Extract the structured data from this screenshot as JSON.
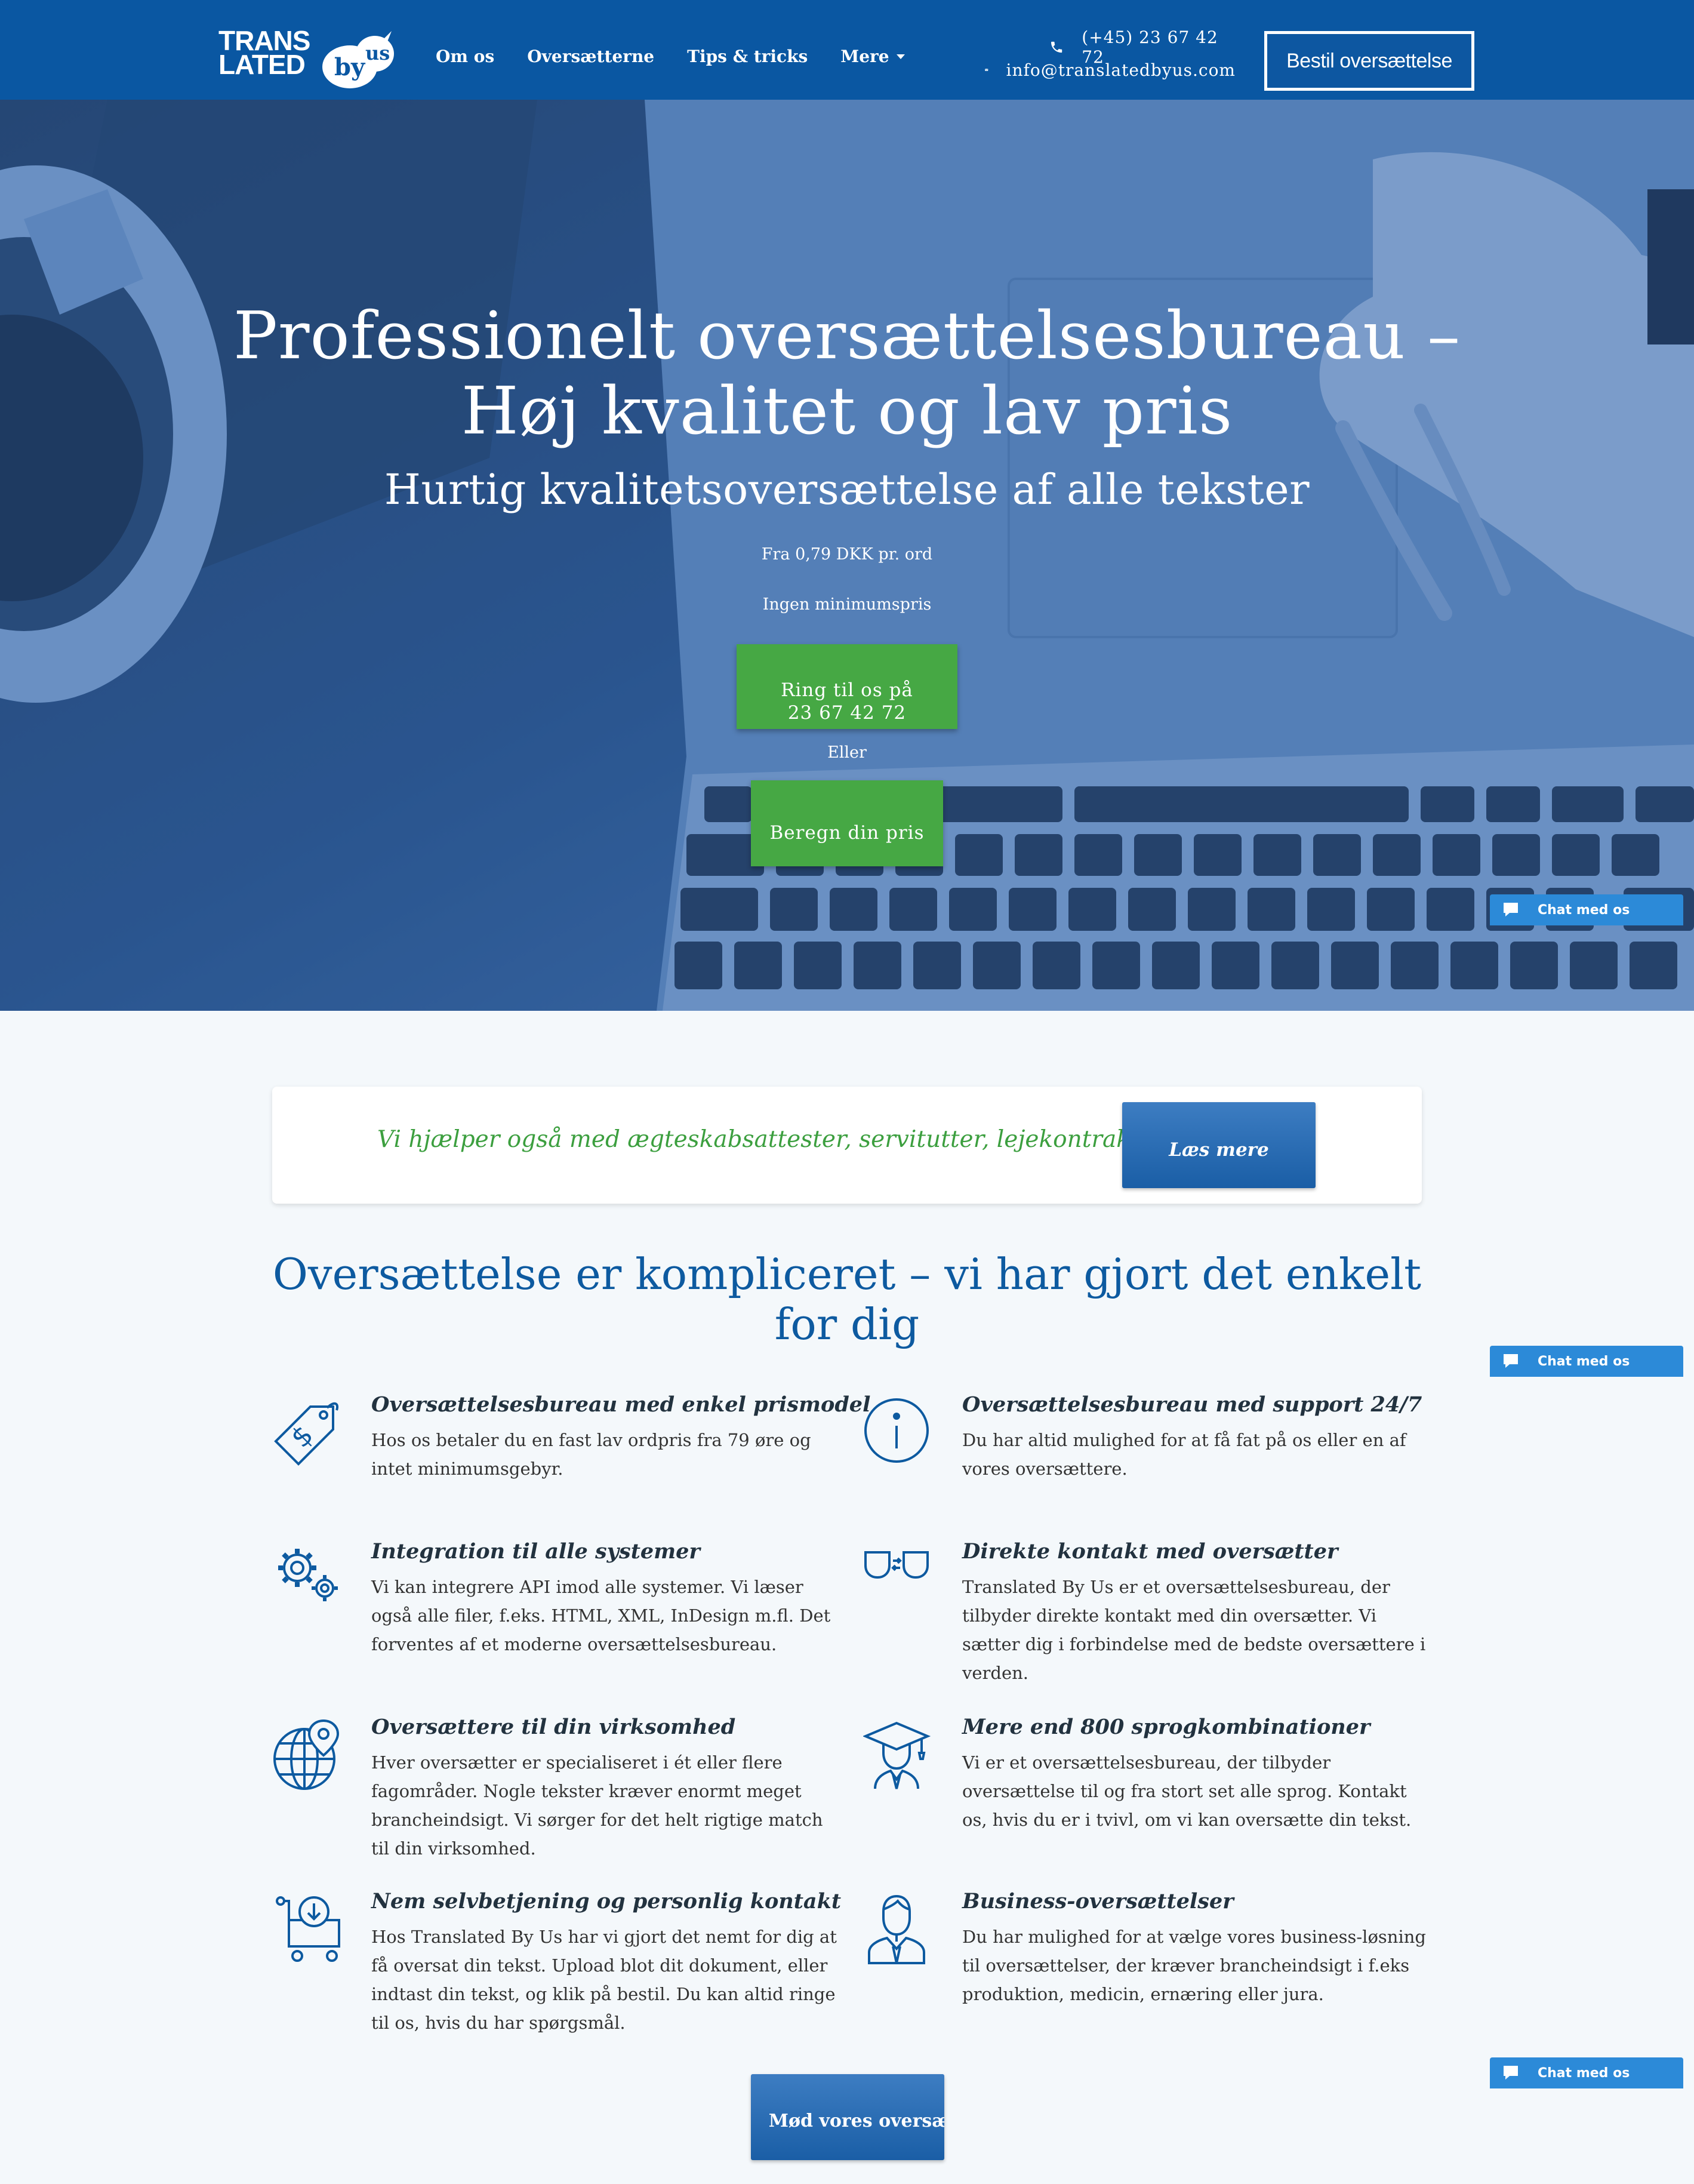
{
  "header": {
    "logo_line1": "TRANS",
    "logo_line2": "LATED",
    "logo_by": "by",
    "logo_us": "us",
    "nav": {
      "about": "Om os",
      "translators": "Oversætterne",
      "tips": "Tips & tricks",
      "more": "Mere"
    },
    "phone": "(+45) 23 67 42 72",
    "email": "info@translatedbyus.com",
    "order_button": "Bestil oversættelse"
  },
  "hero": {
    "title_line1": "Professionelt oversættelsesbureau –",
    "title_line2": "Høj kvalitet og lav pris",
    "subtitle": "Hurtig kvalitetsoversættelse af alle tekster",
    "price": "Fra 0,79 DKK pr. ord",
    "no_minimum": "Ingen minimumspris",
    "call_button_line1": "Ring til os på",
    "call_button_line2": "23 67 42 72",
    "or": "Eller",
    "calc_button": "Beregn din pris"
  },
  "chat": {
    "label": "Chat med os"
  },
  "notice": {
    "text": "Vi hjælper også med ægteskabsattester, servitutter, lejekontrakter o.l.",
    "button": "Læs mere"
  },
  "features": {
    "title": "Oversættelse er kompliceret – vi har gjort det enkelt for dig",
    "items": [
      {
        "icon": "price-tag-icon",
        "title": "Oversættelsesbureau med enkel prismodel",
        "text": "Hos os betaler du en fast lav ordpris fra 79 øre og intet minimumsgebyr."
      },
      {
        "icon": "info-icon",
        "title": "Oversættelsesbureau med support 24/7",
        "text": "Du har altid mulighed for at få fat på os eller en af vores oversættere."
      },
      {
        "icon": "gears-icon",
        "title": "Integration til alle systemer",
        "text": "Vi kan integrere API imod alle systemer. Vi læser også alle filer, f.eks. HTML, XML, InDesign m.fl. Det forventes af et moderne oversættelsesbureau."
      },
      {
        "icon": "connection-icon",
        "title": "Direkte kontakt med oversætter",
        "text": "Translated By Us er et oversættelsesbureau, der tilbyder direkte kontakt med din oversætter. Vi sætter dig i forbindelse med de bedste oversættere i verden."
      },
      {
        "icon": "globe-pin-icon",
        "title": "Oversættere til din virksomhed",
        "text": "Hver oversætter er specialiseret i ét eller flere fagområder. Nogle tekster kræver enormt meget brancheindsigt. Vi sørger for det helt rigtige match til din virksomhed."
      },
      {
        "icon": "graduate-icon",
        "title": "Mere end 800 sprogkombinationer",
        "text": "Vi er et oversættelsesbureau, der tilbyder oversættelse til og fra stort set alle sprog. Kontakt os, hvis du er i tvivl, om vi kan oversætte din tekst."
      },
      {
        "icon": "cart-download-icon",
        "title": "Nem selvbetjening og personlig kontakt",
        "text": "Hos Translated By Us har vi gjort det nemt for dig at få oversat din tekst. Upload blot dit dokument, eller indtast din tekst, og klik på bestil. Du kan altid ringe til os, hvis du har spørgsmål."
      },
      {
        "icon": "businessman-icon",
        "title": "Business-oversættelser",
        "text": "Du har mulighed for at vælge vores business-løsning til oversættelser, der kræver brancheindsigt i f.eks produktion, medicin, ernæring eller jura."
      }
    ],
    "meet_button": "Mød vores oversættere"
  },
  "colors": {
    "header_blue": "#0a57a2",
    "accent_green": "#46a844",
    "title_blue": "#0d5aa0",
    "chat_blue": "#2c8ad8"
  }
}
